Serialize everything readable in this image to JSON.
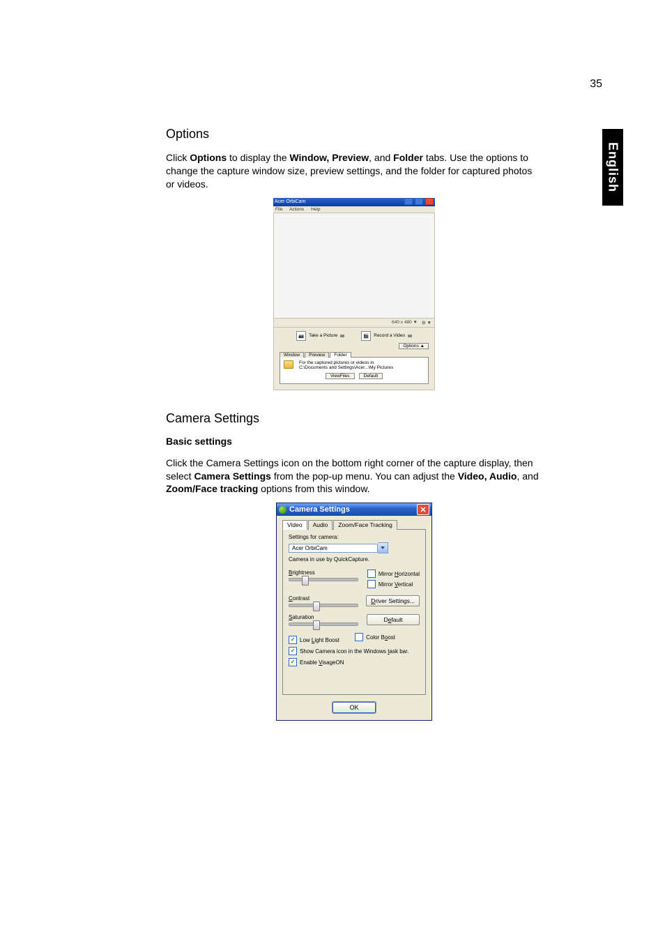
{
  "pagenum": "35",
  "lang_tab": "English",
  "sec1": {
    "heading": "Options",
    "p1_a": "Click ",
    "p1_b": "Options",
    "p1_c": " to display the ",
    "p1_d": "Window, Preview",
    "p1_e": ", and ",
    "p1_f": "Folder",
    "p1_g": " tabs. Use the options to change the capture window size, preview settings, and the folder for captured photos or videos.",
    "fig": {
      "title": "Acer OrbiCam",
      "menu": {
        "file": "File",
        "actions": "Actions",
        "help": "Help"
      },
      "status": {
        "res": "640 x 480 ▼",
        "gear": "⚙ ▼"
      },
      "actions": {
        "take": "Take a Picture",
        "record": "Record a Video"
      },
      "options_btn": "Options  ▲",
      "tabs": {
        "window": "Window",
        "preview": "Preview",
        "folder": "Folder"
      },
      "folder": {
        "label": "For the captured pictures or videos in",
        "path": "C:\\Documents and Settings\\Acer...\\My Pictures",
        "viewfiles": "ViewFiles",
        "default": "Default"
      }
    }
  },
  "sec2": {
    "heading": "Camera Settings",
    "sub": "Basic settings",
    "p1_a": "Click the Camera Settings icon on the bottom right corner of the capture display, then select ",
    "p1_b": "Camera Settings",
    "p1_c": " from the pop-up menu. You can adjust the ",
    "p1_d": "Video, Audio",
    "p1_e": ", and ",
    "p1_f": "Zoom/Face tracking",
    "p1_g": " options from this window.",
    "fig": {
      "title": "Camera Settings",
      "tabs": {
        "video": "Video",
        "audio": "Audio",
        "zoom": "Zoom/Face Tracking"
      },
      "cam_label": "Settings for camera:",
      "cam_value": "Acer OrbiCam",
      "inuse": "Camera in use by QuickCapture.",
      "brightness": "Brightness",
      "contrast": "Contrast",
      "saturation": "Saturation",
      "mirror_h": "Mirror Horizontal",
      "mirror_v": "Mirror Vertical",
      "driver_btn": "Driver Settings...",
      "default_btn": "Default",
      "low_light": "Low Light Boost",
      "color_boost": "Color Boost",
      "show_icon": "Show Camera icon in the Windows task bar.",
      "enable_visage": "Enable VisageON",
      "ok": "OK"
    }
  }
}
